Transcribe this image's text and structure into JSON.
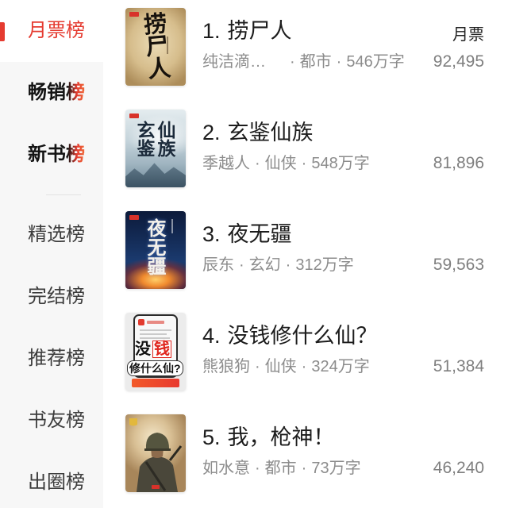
{
  "sidebar": {
    "items": [
      {
        "label": "月票榜"
      },
      {
        "label": "畅销榜"
      },
      {
        "label": "新书榜"
      },
      {
        "label": "精选榜"
      },
      {
        "label": "完结榜"
      },
      {
        "label": "推荐榜"
      },
      {
        "label": "书友榜"
      },
      {
        "label": "出圈榜"
      }
    ],
    "selected_index": 0
  },
  "list": {
    "metric_label": "月票",
    "separator": "·",
    "books": [
      {
        "rank": "1.",
        "title": "捞尸人",
        "author": "纯洁滴…",
        "genre": "都市",
        "word_count": "546万字",
        "monthly_tickets": "92,495",
        "cover_text": "捞尸人"
      },
      {
        "rank": "2.",
        "title": "玄鉴仙族",
        "author": "季越人",
        "genre": "仙侠",
        "word_count": "548万字",
        "monthly_tickets": "81,896",
        "cover_text": "玄鉴仙族"
      },
      {
        "rank": "3.",
        "title": "夜无疆",
        "author": "辰东",
        "genre": "玄幻",
        "word_count": "312万字",
        "monthly_tickets": "59,563",
        "cover_text": "夜无疆"
      },
      {
        "rank": "4.",
        "title": "没钱修什么仙？",
        "author": "熊狼狗",
        "genre": "仙侠",
        "word_count": "324万字",
        "monthly_tickets": "51,384",
        "cover_text": [
          "没",
          "钱",
          "修什么仙?"
        ]
      },
      {
        "rank": "5.",
        "title": "我，枪神！",
        "author": "如水意",
        "genre": "都市",
        "word_count": "73万字",
        "monthly_tickets": "46,240"
      }
    ]
  },
  "colors": {
    "accent": "#e53b30",
    "title_text": "#1c1c1c",
    "meta_text": "#8c8c8c",
    "sidebar_bg": "#f7f7f7"
  }
}
